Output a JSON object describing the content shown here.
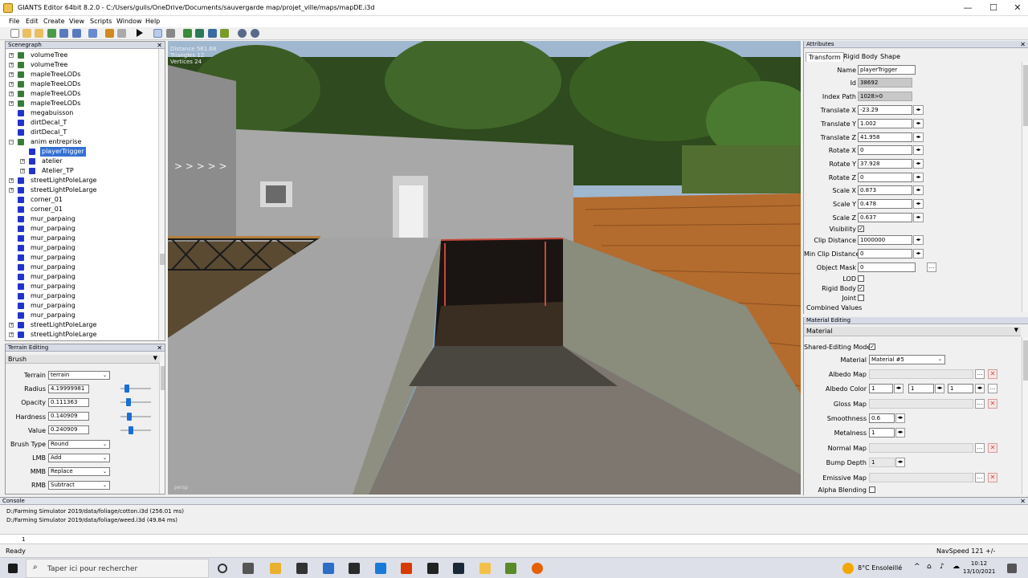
{
  "window": {
    "title": "GIANTS Editor 64bit 8.2.0 - C:/Users/guils/OneDrive/Documents/sauvergarde map/projet_ville/maps/mapDE.i3d",
    "minimize": "—",
    "maximize": "☐",
    "close": "✕"
  },
  "menu": [
    "File",
    "Edit",
    "Create",
    "View",
    "Scripts",
    "Window",
    "Help"
  ],
  "scenegraph": {
    "title": "Scenegraph",
    "items": [
      {
        "label": "volumeTree"
      },
      {
        "label": "volumeTree"
      },
      {
        "label": "mapleTreeLODs"
      },
      {
        "label": "mapleTreeLODs"
      },
      {
        "label": "mapleTreeLODs"
      },
      {
        "label": "mapleTreeLODs"
      },
      {
        "label": "megabuisson"
      },
      {
        "label": "dirtDecal_T"
      },
      {
        "label": "dirtDecal_T"
      },
      {
        "label": "anim entreprise"
      },
      {
        "label": "playerTrigger"
      },
      {
        "label": "atelier"
      },
      {
        "label": "Atelier_TP"
      },
      {
        "label": "streetLightPoleLarge"
      },
      {
        "label": "streetLightPoleLarge"
      },
      {
        "label": "corner_01"
      },
      {
        "label": "corner_01"
      },
      {
        "label": "mur_parpaing"
      },
      {
        "label": "mur_parpaing"
      },
      {
        "label": "mur_parpaing"
      },
      {
        "label": "mur_parpaing"
      },
      {
        "label": "mur_parpaing"
      },
      {
        "label": "mur_parpaing"
      },
      {
        "label": "mur_parpaing"
      },
      {
        "label": "mur_parpaing"
      },
      {
        "label": "mur_parpaing"
      },
      {
        "label": "mur_parpaing"
      },
      {
        "label": "mur_parpaing"
      },
      {
        "label": "streetLightPoleLarge"
      },
      {
        "label": "streetLightPoleLarge"
      }
    ]
  },
  "terrain": {
    "title": "Terrain Editing",
    "section": "Brush",
    "terrain_label": "Terrain",
    "terrain_value": "terrain",
    "radius_label": "Radius",
    "radius_value": "4.19999981",
    "opacity_label": "Opacity",
    "opacity_value": "0.111363",
    "hardness_label": "Hardness",
    "hardness_value": "0.140909",
    "value_label": "Value",
    "value_value": "0.240909",
    "brushtype_label": "Brush Type",
    "brushtype_value": "Round",
    "lmb_label": "LMB",
    "lmb_value": "Add",
    "mmb_label": "MMB",
    "mmb_value": "Replace",
    "rmb_label": "RMB",
    "rmb_value": "Subtract",
    "slider_levels": [
      0.2,
      0.2,
      0.24,
      0.3
    ]
  },
  "viewport": {
    "distance": "Distance 561.68",
    "triangles": "Triangles 12",
    "vertices": "Vertices 24",
    "camera": "persp"
  },
  "attributes": {
    "title": "Attributes",
    "tabs": [
      "Transform",
      "Rigid Body",
      "Shape"
    ],
    "name_label": "Name",
    "name_value": "playerTrigger",
    "id_label": "Id",
    "id_value": "38692",
    "indexpath_label": "Index Path",
    "indexpath_value": "1028>0",
    "tx_label": "Translate X",
    "tx_value": "-23.29",
    "ty_label": "Translate Y",
    "ty_value": "1.002",
    "tz_label": "Translate Z",
    "tz_value": "41.958",
    "rx_label": "Rotate X",
    "rx_value": "0",
    "ry_label": "Rotate Y",
    "ry_value": "37.928",
    "rz_label": "Rotate Z",
    "rz_value": "0",
    "sx_label": "Scale X",
    "sx_value": "0.873",
    "sy_label": "Scale Y",
    "sy_value": "0.478",
    "sz_label": "Scale Z",
    "sz_value": "0.637",
    "visibility_label": "Visibility",
    "clip_label": "Clip Distance",
    "clip_value": "1000000",
    "minclip_label": "Min Clip Distance",
    "minclip_value": "0",
    "objmask_label": "Object Mask",
    "objmask_value": "0",
    "lod_label": "LOD",
    "rigidbody_label": "Rigid Body",
    "joint_label": "Joint",
    "combined_label": "Combined Values",
    "dots": "..."
  },
  "material": {
    "title": "Material Editing",
    "section": "Material",
    "shared_label": "Shared-Editing Mode",
    "material_label": "Material",
    "material_value": "Material #5",
    "albedomap_label": "Albedo Map",
    "albedocolor_label": "Albedo Color",
    "albedo_r": "1",
    "albedo_g": "1",
    "albedo_b": "1",
    "glossmap_label": "Gloss Map",
    "smoothness_label": "Smoothness",
    "smoothness_value": "0.6",
    "metalness_label": "Metalness",
    "metalness_value": "1",
    "normalmap_label": "Normal Map",
    "bumpdepth_label": "Bump Depth",
    "bumpdepth_value": "1",
    "emissivemap_label": "Emissive Map",
    "alphablending_label": "Alpha Blending"
  },
  "console": {
    "title": "Console",
    "lines": [
      "D:/Farming Simulator 2019/data/foliage/cotton.i3d (256.01 ms)",
      "D:/Farming Simulator 2019/data/foliage/weed.i3d (49.84 ms)"
    ],
    "input_line": "1"
  },
  "status": {
    "left": "Ready",
    "right": "NavSpeed 121 +/-"
  },
  "taskbar": {
    "search_placeholder": "Taper ici pour rechercher",
    "weather": "8°C  Ensoleillé",
    "time": "10:12",
    "date": "13/10/2021"
  }
}
